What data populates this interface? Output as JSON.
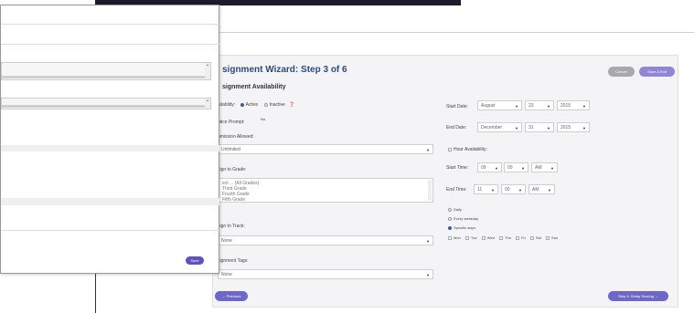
{
  "wizard": {
    "title": "signment Wizard: Step 3 of 6",
    "cancel_label": "Cancel",
    "save_exit_label": "Save & Exit",
    "section_title": "signment Availability"
  },
  "availability": {
    "label": "ailability:",
    "active_label": "Active",
    "inactive_label": "Inactive",
    "selected": "Active"
  },
  "notice_prompt": {
    "label": "otice Prompt:",
    "value": "No"
  },
  "submission": {
    "label": "bmission Allowed:",
    "value": "Unlimited"
  },
  "grade": {
    "label": "sign to Grade:",
    "options": [
      "ect ... (All Grades)",
      "Third Grade",
      "Fourth Grade",
      "Fifth Grade"
    ]
  },
  "track": {
    "label": "sign to Track:",
    "value": "None"
  },
  "tags": {
    "label": "signment Tags:",
    "value": "None"
  },
  "start_date": {
    "label": "Start Date:",
    "month": "August",
    "day": "23",
    "year": "2015"
  },
  "end_date": {
    "label": "End Date:",
    "month": "December",
    "day": "31",
    "year": "2015"
  },
  "hour_availability": {
    "label": "Hour Availability:"
  },
  "start_time": {
    "label": "Start Time:",
    "hour": "09",
    "minute": "00",
    "ampm": "AM"
  },
  "end_time": {
    "label": "End Time:",
    "hour": "11",
    "minute": "00",
    "ampm": "AM"
  },
  "schedule": {
    "daily": "Daily",
    "weekday": "Every weekday",
    "specific": "Specific days:",
    "selected": "Specific days:",
    "days": [
      "Mon",
      "Tue",
      "Wed",
      "Thu",
      "Fri",
      "Sat",
      "Sun"
    ]
  },
  "nav": {
    "previous_label": "← Previous",
    "next_label": "Step 4: Setup Scoring →"
  },
  "modal": {
    "placeholder": "....",
    "button_label": "Save"
  },
  "colors": {
    "accent": "#6f67c8",
    "title": "#2b4b78",
    "cancel": "#a9a9ab"
  }
}
